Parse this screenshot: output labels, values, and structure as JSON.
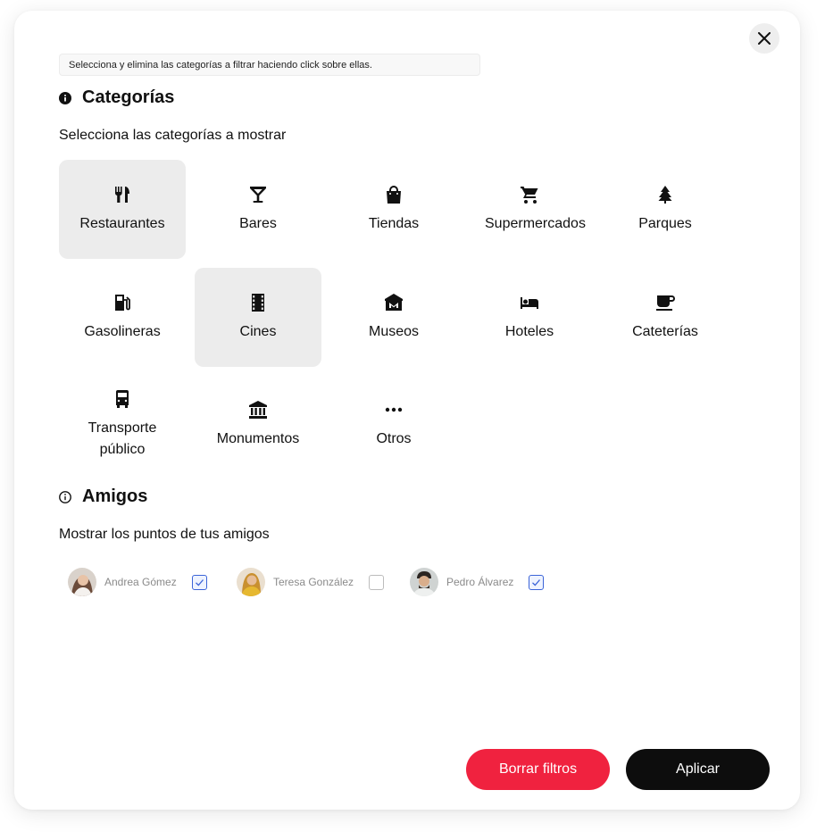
{
  "hint": "Selecciona y elimina las categorías a filtrar haciendo click sobre ellas.",
  "categories_section": {
    "title": "Categorías",
    "subtitle": "Selecciona las categorías a mostrar",
    "items": [
      {
        "label": "Restaurantes",
        "icon": "restaurant-icon",
        "selected": true
      },
      {
        "label": "Bares",
        "icon": "cocktail-icon",
        "selected": false
      },
      {
        "label": "Tiendas",
        "icon": "shopping-bag-icon",
        "selected": false
      },
      {
        "label": "Supermercados",
        "icon": "shopping-cart-icon",
        "selected": false
      },
      {
        "label": "Parques",
        "icon": "tree-icon",
        "selected": false
      },
      {
        "label": "Gasolineras",
        "icon": "gas-station-icon",
        "selected": false
      },
      {
        "label": "Cines",
        "icon": "film-icon",
        "selected": true
      },
      {
        "label": "Museos",
        "icon": "museum-icon",
        "selected": false
      },
      {
        "label": "Hoteles",
        "icon": "bed-icon",
        "selected": false
      },
      {
        "label": "Cateterías",
        "icon": "coffee-icon",
        "selected": false
      },
      {
        "label": "Transporte público",
        "icon": "bus-icon",
        "selected": false
      },
      {
        "label": "Monumentos",
        "icon": "bank-icon",
        "selected": false
      },
      {
        "label": "Otros",
        "icon": "more-horizontal-icon",
        "selected": false
      }
    ]
  },
  "friends_section": {
    "title": "Amigos",
    "subtitle": "Mostrar los puntos de tus amigos",
    "friends": [
      {
        "name": "Andrea Gómez",
        "checked": true
      },
      {
        "name": "Teresa González",
        "checked": false
      },
      {
        "name": "Pedro Álvarez",
        "checked": true
      }
    ]
  },
  "buttons": {
    "clear": "Borrar filtros",
    "apply": "Aplicar"
  },
  "colors": {
    "accent_red": "#f0223f",
    "apply_black": "#0d0d0d",
    "selected_bg": "#ececec",
    "check_blue": "#3b64d8"
  }
}
